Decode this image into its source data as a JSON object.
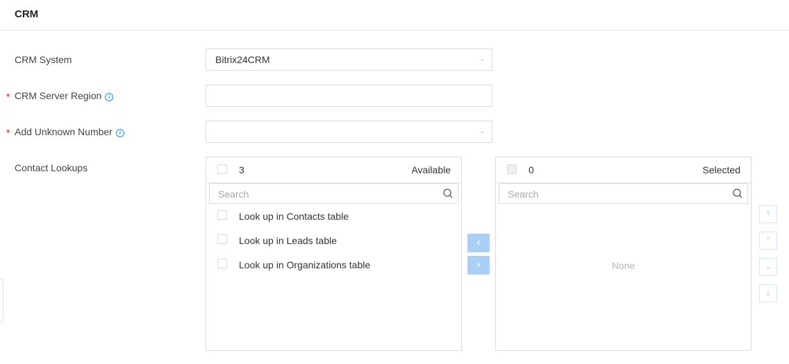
{
  "header": {
    "title": "CRM"
  },
  "form": {
    "crm_system": {
      "label": "CRM System",
      "value": "Bitrix24CRM"
    },
    "server_region": {
      "label": "CRM Server Region",
      "required_mark": "*",
      "info_icon": "info-circle-icon",
      "value": ""
    },
    "unknown_number": {
      "label": "Add Unknown Number",
      "required_mark": "*",
      "info_icon": "info-circle-icon",
      "value": ""
    },
    "contact_lookups": {
      "label": "Contact Lookups"
    }
  },
  "transfer": {
    "available": {
      "count": "3",
      "title": "Available",
      "search_placeholder": "Search",
      "items": [
        {
          "label": "Look up in Contacts table"
        },
        {
          "label": "Look up in Leads table"
        },
        {
          "label": "Look up in Organizations table"
        }
      ]
    },
    "selected": {
      "count": "0",
      "title": "Selected",
      "search_placeholder": "Search",
      "empty_text": "None"
    },
    "move_left_icon": "chevron-left-icon",
    "move_right_icon": "chevron-right-icon",
    "sort_icons": [
      "move-to-top-icon",
      "move-up-icon",
      "move-down-icon",
      "move-to-bottom-icon"
    ]
  },
  "colors": {
    "accent": "#1890ff",
    "required": "#f5222d",
    "button_disabled": "#a9d1f7"
  }
}
